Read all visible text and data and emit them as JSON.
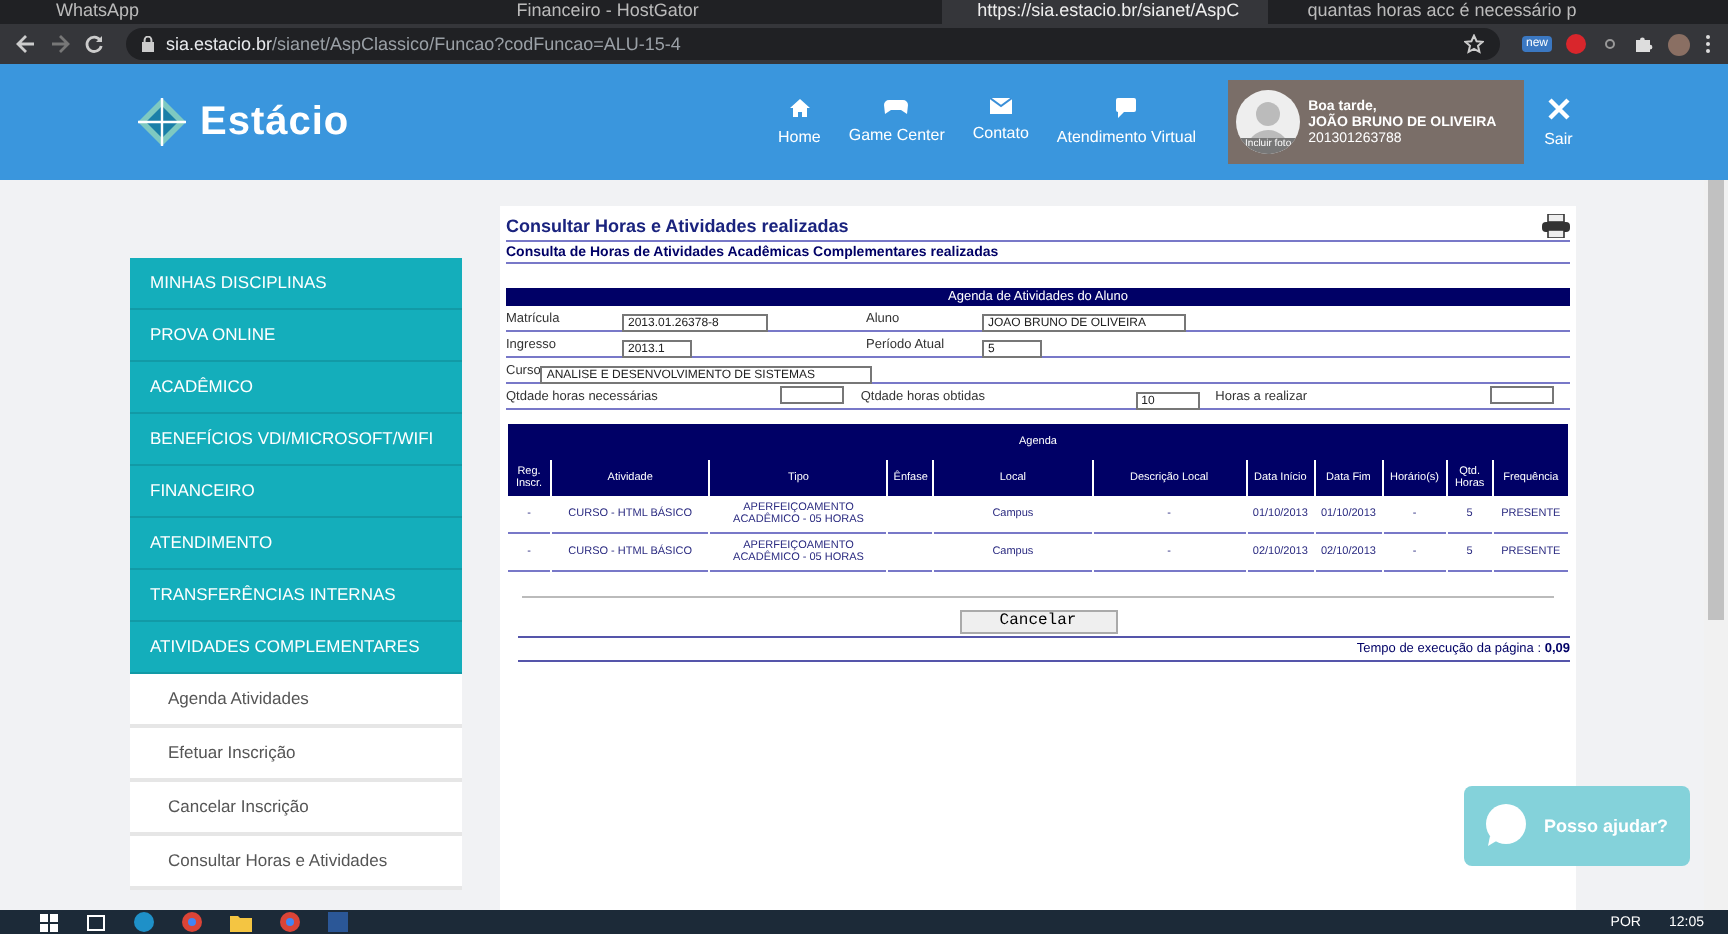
{
  "browser": {
    "tabs": [
      {
        "title": "WhatsApp",
        "selected": false
      },
      {
        "title": "Financeiro - HostGator",
        "selected": false
      },
      {
        "title": "https://sia.estacio.br/sianet/AspC",
        "selected": true
      },
      {
        "title": "quantas horas acc é necessário p",
        "selected": false
      }
    ],
    "address_host": "sia.estacio.br",
    "address_path": "/sianet/AspClassico/Funcao?codFuncao=ALU-15-4",
    "extension_badge": "new"
  },
  "header": {
    "logo": "Estácio",
    "nav": [
      {
        "label": "Home",
        "kind": "home"
      },
      {
        "label": "Game Center",
        "kind": "game"
      },
      {
        "label": "Contato",
        "kind": "mail"
      },
      {
        "label": "Atendimento Virtual",
        "kind": "chat"
      }
    ],
    "user": {
      "photo_label": "Incluir foto",
      "greeting": "Boa tarde,",
      "name": "JOÃO BRUNO DE OLIVEIRA",
      "id": "201301263788"
    },
    "logout": "Sair"
  },
  "sidebar": {
    "items": [
      {
        "label": "MINHAS DISCIPLINAS"
      },
      {
        "label": "PROVA ONLINE"
      },
      {
        "label": "ACADÊMICO"
      },
      {
        "label": "BENEFÍCIOS VDI/MICROSOFT/WIFI"
      },
      {
        "label": "FINANCEIRO"
      },
      {
        "label": "ATENDIMENTO"
      },
      {
        "label": "TRANSFERÊNCIAS INTERNAS"
      },
      {
        "label": "ATIVIDADES COMPLEMENTARES",
        "children": [
          {
            "label": "Agenda Atividades"
          },
          {
            "label": "Efetuar Inscrição"
          },
          {
            "label": "Cancelar Inscrição"
          },
          {
            "label": "Consultar Horas e Atividades"
          }
        ]
      }
    ]
  },
  "page": {
    "title": "Consultar Horas e Atividades realizadas",
    "subtitle": "Consulta de Horas de Atividades Acadêmicas Complementares realizadas",
    "student": {
      "heading": "Agenda de Atividades do Aluno",
      "rows": [
        [
          {
            "label": "Matrícula",
            "value": "2013.01.26378-8"
          },
          {
            "label": "Aluno",
            "value": "JOAO BRUNO DE OLIVEIRA"
          }
        ],
        [
          {
            "label": "Ingresso",
            "value": "2013.1"
          },
          {
            "label": "Período Atual",
            "value": "5"
          }
        ],
        [
          {
            "label": "Curso",
            "value": "ANALISE E DESENVOLVIMENTO DE SISTEMAS"
          }
        ],
        [
          {
            "label": "Qtdade horas necessárias"
          },
          {
            "label": "Qtdade horas obtidas",
            "value": "10"
          },
          {
            "label": "Horas a realizar"
          }
        ]
      ]
    },
    "agenda": {
      "heading": "Agenda",
      "columns": [
        "Reg. Inscr.",
        "Atividade",
        "Tipo",
        "Ênfase",
        "Local",
        "Descrição Local",
        "Data Início",
        "Data Fim",
        "Horário(s)",
        "Qtd. Horas",
        "Frequência"
      ],
      "rows": [
        [
          "-",
          "CURSO - HTML BÁSICO",
          "APERFEIÇOAMENTO ACADÊMICO - 05 HORAS",
          "",
          "Campus",
          "-",
          "01/10/2013",
          "01/10/2013",
          "-",
          "5",
          "PRESENTE"
        ],
        [
          "-",
          "CURSO - HTML BÁSICO",
          "APERFEIÇOAMENTO ACADÊMICO - 05 HORAS",
          "",
          "Campus",
          "-",
          "02/10/2013",
          "02/10/2013",
          "-",
          "5",
          "PRESENTE"
        ]
      ]
    },
    "cancel_button": "Cancelar",
    "footer_label": "Tempo de execução da página :",
    "footer_value": "0,09"
  },
  "chat": {
    "label": "Posso ajudar?"
  },
  "taskbar": {
    "language": "POR",
    "time": "12:05"
  }
}
